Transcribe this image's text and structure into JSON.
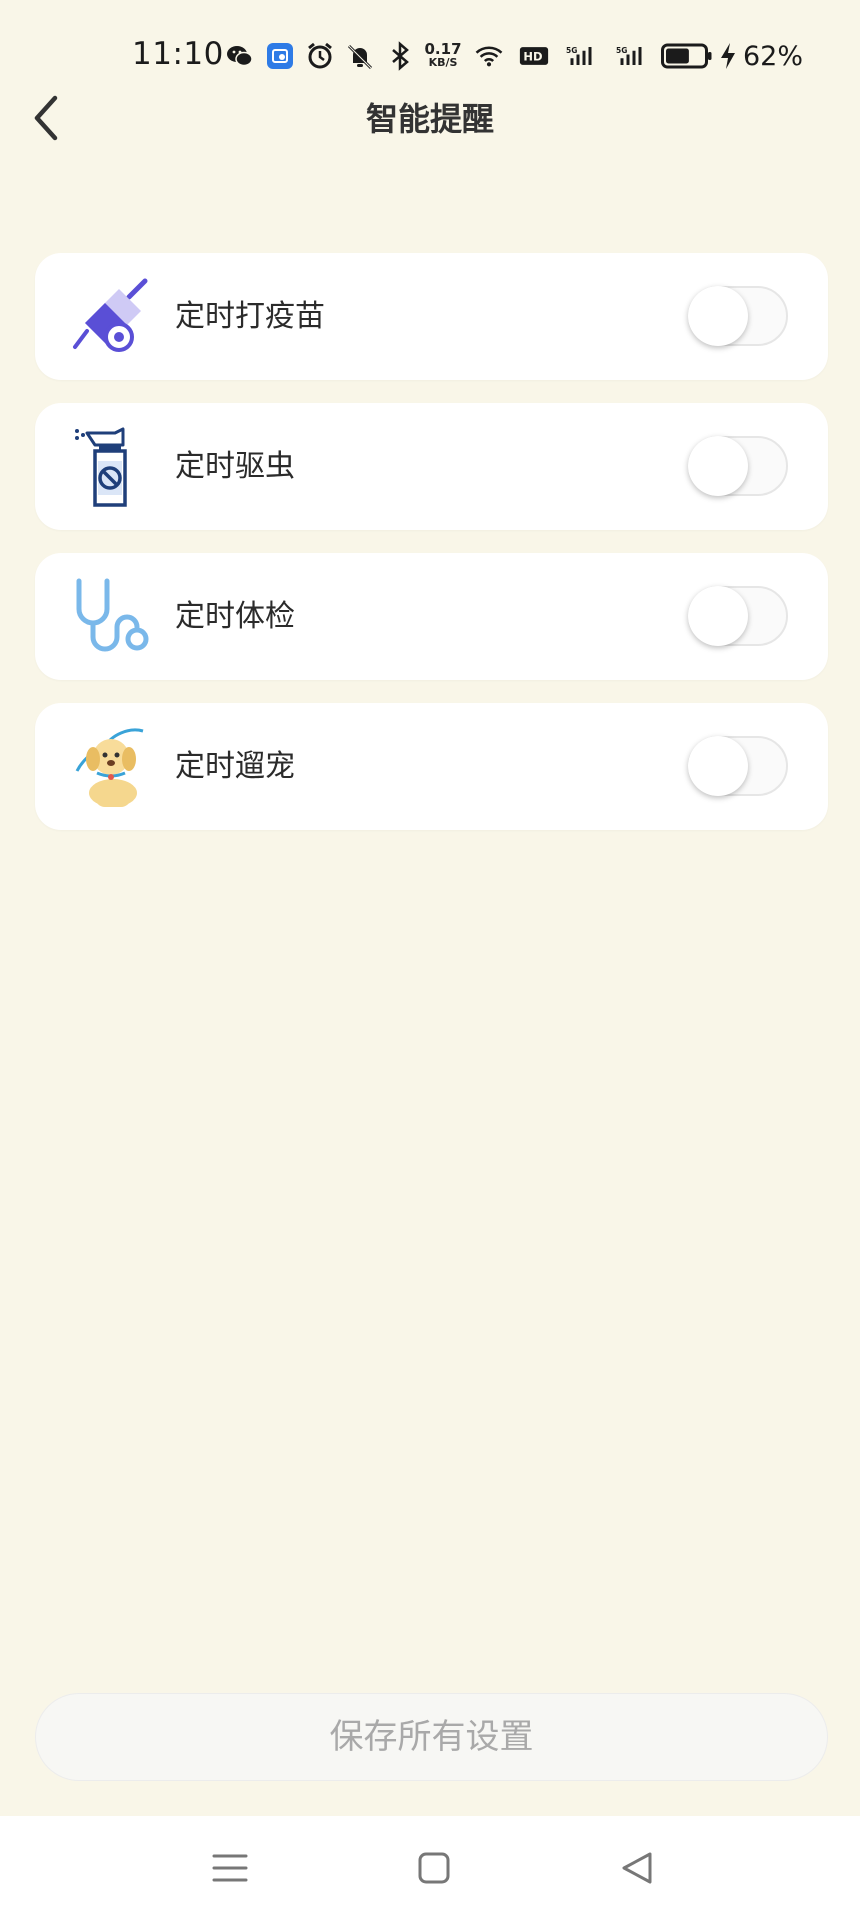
{
  "status_bar": {
    "time": "11:10",
    "net_speed_value": "0.17",
    "net_speed_unit": "KB/S",
    "network_1": "5G",
    "network_2": "5G",
    "battery_percent": "62%",
    "battery_level": 0.62
  },
  "header": {
    "title": "智能提醒"
  },
  "reminders": [
    {
      "label": "定时打疫苗",
      "icon": "vaccine-syringe-icon",
      "enabled": false
    },
    {
      "label": "定时驱虫",
      "icon": "deworm-spray-icon",
      "enabled": false
    },
    {
      "label": "定时体检",
      "icon": "stethoscope-icon",
      "enabled": false
    },
    {
      "label": "定时遛宠",
      "icon": "dog-leash-icon",
      "enabled": false
    }
  ],
  "save_button": {
    "label": "保存所有设置"
  },
  "colors": {
    "background": "#f9f6e8",
    "card": "#ffffff",
    "toggle_off": "#fafafa"
  }
}
